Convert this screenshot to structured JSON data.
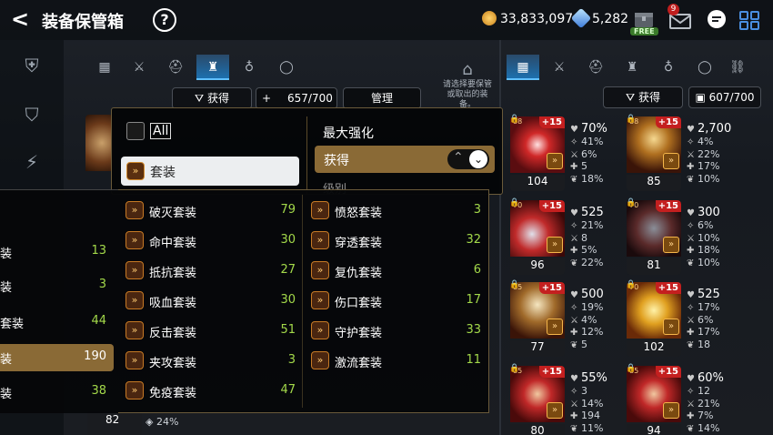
{
  "header": {
    "back": "<",
    "title": "装备保管箱",
    "help": "?"
  },
  "currencies": {
    "gold": "33,833,097",
    "gems": "5,282"
  },
  "topbar": {
    "free_label": "FREE",
    "mail_badge": "9"
  },
  "tabs_left": [
    "▦",
    "⚔",
    "⛑",
    "♜",
    "♁",
    "◯",
    "⛓"
  ],
  "tabs_right": [
    "▦",
    "⚔",
    "⛑",
    "♜",
    "♁",
    "◯",
    "⛓"
  ],
  "storage": {
    "filter_label": "获得",
    "plus": "+",
    "capacity": "657/700",
    "manage_label": "管理",
    "hint": "请选择要保管或取出的装备。"
  },
  "inventory": {
    "filter_label": "获得",
    "capacity": "607/700"
  },
  "popup": {
    "all_label": "All",
    "set_button_label": "套装",
    "sort_header": "最大强化",
    "sort_selected": "获得",
    "partial_label": "级别"
  },
  "categories": [
    {
      "label": "装",
      "count": "13"
    },
    {
      "label": "装",
      "count": "3"
    },
    {
      "label": "套装",
      "count": "44"
    },
    {
      "label": "装",
      "count": "190"
    },
    {
      "label": "装",
      "count": "38"
    }
  ],
  "sets_col1": [
    {
      "label": "破灭套装",
      "count": "79"
    },
    {
      "label": "命中套装",
      "count": "30"
    },
    {
      "label": "抵抗套装",
      "count": "27"
    },
    {
      "label": "吸血套装",
      "count": "30"
    },
    {
      "label": "反击套装",
      "count": "51"
    },
    {
      "label": "夹攻套装",
      "count": "3"
    },
    {
      "label": "免疫套装",
      "count": "47"
    }
  ],
  "sets_col2": [
    {
      "label": "愤怒套装",
      "count": "3"
    },
    {
      "label": "穿透套装",
      "count": "32"
    },
    {
      "label": "复仇套装",
      "count": "6"
    },
    {
      "label": "伤口套装",
      "count": "17"
    },
    {
      "label": "守护套装",
      "count": "33"
    },
    {
      "label": "激流套装",
      "count": "11"
    }
  ],
  "storage_items": [
    {
      "level": "82",
      "stat": "24%"
    }
  ],
  "inventory_items": [
    {
      "plus": "+15",
      "level": "104",
      "small": "88",
      "main": "70%",
      "s1": "41%",
      "s2": "6%",
      "s3": "5",
      "s4": "18%"
    },
    {
      "plus": "+15",
      "level": "85",
      "small": "88",
      "main": "2,700",
      "s1": "4%",
      "s2": "22%",
      "s3": "17%",
      "s4": "10%"
    },
    {
      "plus": "+15",
      "level": "96",
      "small": "70",
      "main": "525",
      "s1": "21%",
      "s2": "8",
      "s3": "5%",
      "s4": "22%"
    },
    {
      "plus": "+15",
      "level": "81",
      "small": "70",
      "main": "300",
      "s1": "6%",
      "s2": "10%",
      "s3": "18%",
      "s4": "10%"
    },
    {
      "plus": "+15",
      "level": "77",
      "small": "85",
      "main": "500",
      "s1": "19%",
      "s2": "4%",
      "s3": "12%",
      "s4": "5"
    },
    {
      "plus": "+15",
      "level": "102",
      "small": "70",
      "main": "525",
      "s1": "17%",
      "s2": "6%",
      "s3": "17%",
      "s4": "18"
    },
    {
      "plus": "+15",
      "level": "80",
      "small": "85",
      "main": "55%",
      "s1": "3",
      "s2": "14%",
      "s3": "194",
      "s4": "11%"
    },
    {
      "plus": "+15",
      "level": "94",
      "small": "85",
      "main": "60%",
      "s1": "12",
      "s2": "21%",
      "s3": "7%",
      "s4": "14%"
    }
  ]
}
